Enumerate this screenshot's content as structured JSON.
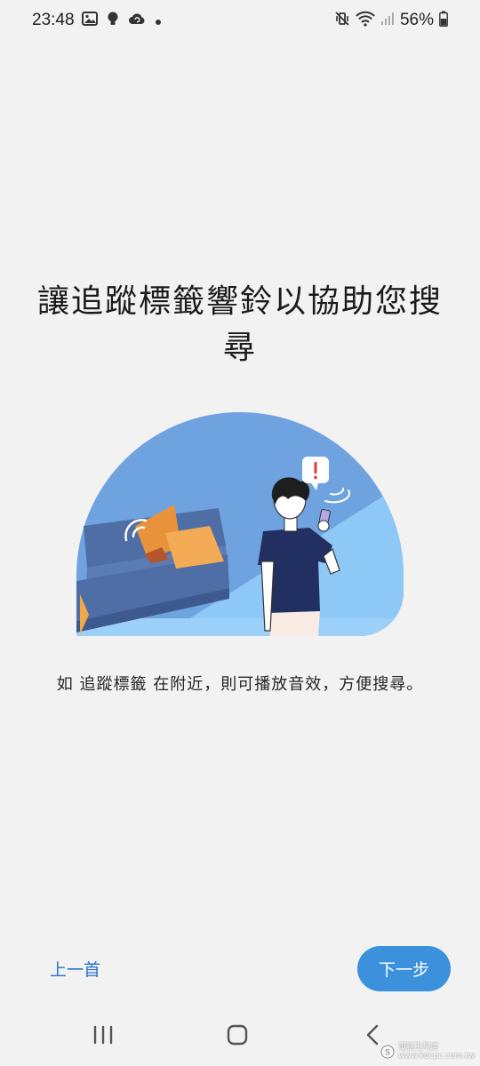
{
  "status_bar": {
    "time": "23:48",
    "left_icons": [
      "gallery-icon",
      "bulb-icon",
      "cloud-sync-icon",
      "dot-icon"
    ],
    "right_icons": [
      "mute-vibrate-icon",
      "wifi-icon",
      "signal-icon",
      "battery-icon"
    ],
    "battery": "56%"
  },
  "page": {
    "title": "讓追蹤標籤響鈴以協助您搜尋",
    "description": "如 追蹤標籤 在附近，則可播放音效，方便搜尋。"
  },
  "buttons": {
    "prev_label": "上一首",
    "next_label": "下一步"
  },
  "nav_bar": {
    "items": [
      "recent-apps-icon",
      "home-icon",
      "back-icon"
    ]
  },
  "colors": {
    "background": "#f2f2f2",
    "accent": "#3b91db",
    "link": "#2470c8",
    "illustration_sky": "#6fa3e0",
    "illustration_floor": "#8ec8f6",
    "sofa": "#5572a8",
    "cushion": "#f0a84a",
    "alert": "#e53935"
  },
  "watermark": {
    "line1": "電腦王阿達",
    "line2": "www.kocpc.com.tw"
  }
}
